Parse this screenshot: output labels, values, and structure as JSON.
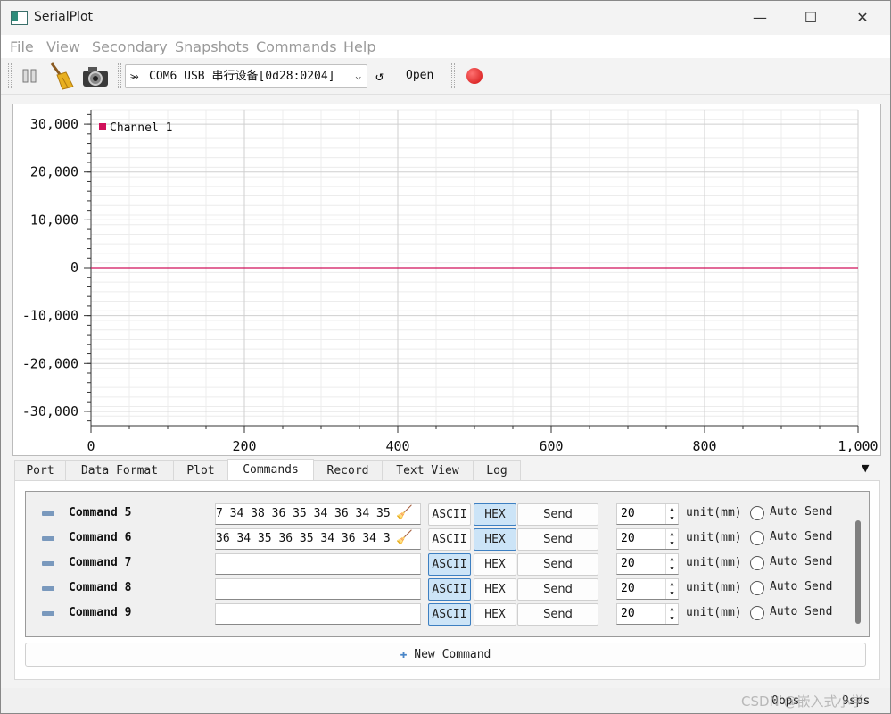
{
  "window": {
    "title": "SerialPlot",
    "minimize": "—",
    "maximize": "☐",
    "close": "✕"
  },
  "menu": [
    "File",
    "View",
    "Secondary",
    "Snapshots",
    "Commands",
    "Help"
  ],
  "toolbar": {
    "port_icon": "usb-icon",
    "port_value": "COM6 USB 串行设备[0d28:0204]",
    "refresh_icon": "↺",
    "open_label": "Open",
    "status_color": "#e02020"
  },
  "chart_data": {
    "type": "line",
    "x_ticks": [
      "0",
      "200",
      "400",
      "600",
      "800",
      "1,000"
    ],
    "y_ticks": [
      "30,000",
      "20,000",
      "10,000",
      "0",
      "-10,000",
      "-20,000",
      "-30,000"
    ],
    "xlim": [
      0,
      1000
    ],
    "ylim": [
      -33000,
      33000
    ],
    "grid": true,
    "legend_placement": "top-left",
    "series": [
      {
        "name": "Channel 1",
        "color": "#d0105a",
        "x": [
          0,
          1000
        ],
        "values": [
          0,
          0
        ]
      }
    ]
  },
  "tabs": [
    {
      "label": "Port",
      "active": false
    },
    {
      "label": "Data Format",
      "active": false
    },
    {
      "label": "Plot",
      "active": false
    },
    {
      "label": "Commands",
      "active": true
    },
    {
      "label": "Record",
      "active": false
    },
    {
      "label": "Text View",
      "active": false
    },
    {
      "label": "Log",
      "active": false
    }
  ],
  "tab_overflow": "▼",
  "commands": [
    {
      "name": "Command 5",
      "value": "7 34 38 36 35 34 36 34 35",
      "ascii": "ASCII",
      "hex": "HEX",
      "mode": "HEX",
      "send": "Send",
      "period": "20",
      "unit": "unit(mm)",
      "auto": "Auto Send",
      "has_clear": true
    },
    {
      "name": "Command 6",
      "value": "36 34 35 36 35 34 36 34 3",
      "ascii": "ASCII",
      "hex": "HEX",
      "mode": "HEX",
      "send": "Send",
      "period": "20",
      "unit": "unit(mm)",
      "auto": "Auto Send",
      "has_clear": true
    },
    {
      "name": "Command 7",
      "value": "",
      "ascii": "ASCII",
      "hex": "HEX",
      "mode": "ASCII",
      "send": "Send",
      "period": "20",
      "unit": "unit(mm)",
      "auto": "Auto Send",
      "has_clear": false
    },
    {
      "name": "Command 8",
      "value": "",
      "ascii": "ASCII",
      "hex": "HEX",
      "mode": "ASCII",
      "send": "Send",
      "period": "20",
      "unit": "unit(mm)",
      "auto": "Auto Send",
      "has_clear": false
    },
    {
      "name": "Command 9",
      "value": "",
      "ascii": "ASCII",
      "hex": "HEX",
      "mode": "ASCII",
      "send": "Send",
      "period": "20",
      "unit": "unit(mm)",
      "auto": "Auto Send",
      "has_clear": false
    }
  ],
  "new_command": {
    "icon": "✚",
    "label": "New Command"
  },
  "status": {
    "bps": "0bps",
    "sps": "9sps"
  },
  "watermark": "CSDN @嵌入式小学"
}
